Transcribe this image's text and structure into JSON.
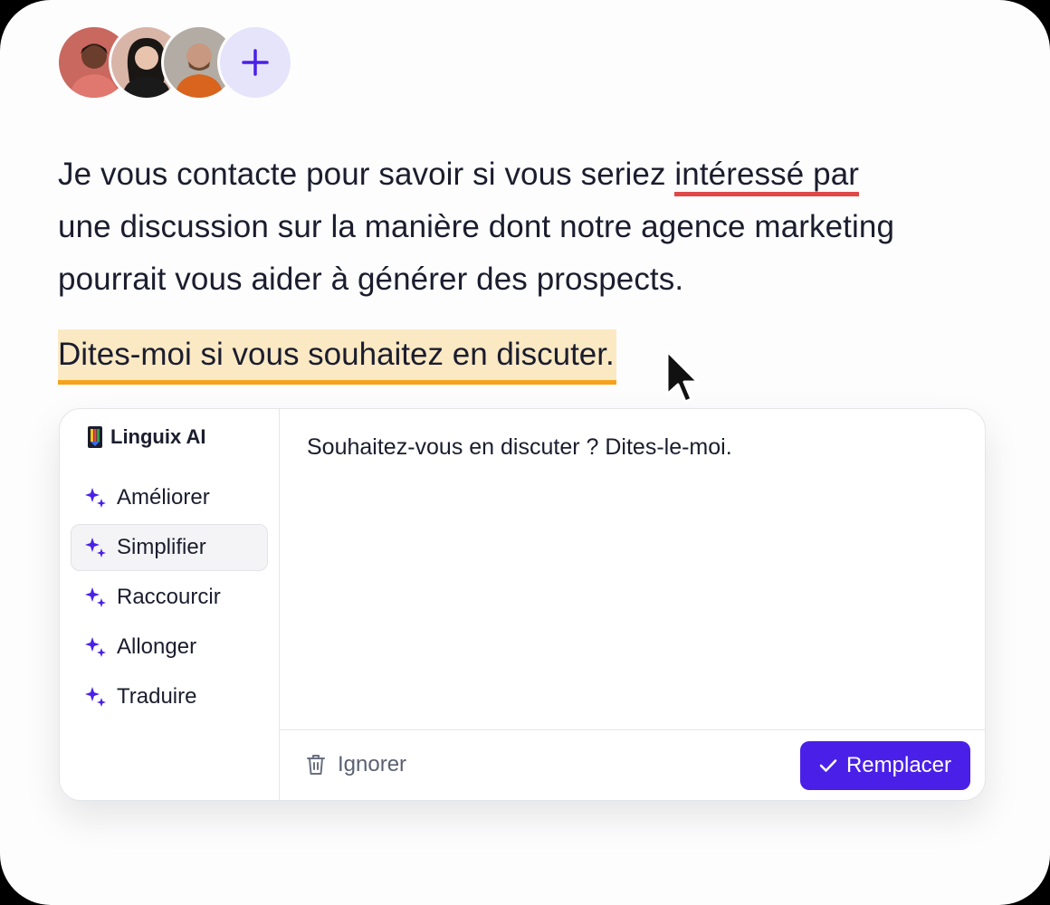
{
  "avatars": [
    {
      "name": "user-avatar-1"
    },
    {
      "name": "user-avatar-2"
    },
    {
      "name": "user-avatar-3"
    }
  ],
  "add_collaborator_icon": "plus-icon",
  "document": {
    "paragraph1": {
      "before": "Je vous contacte pour savoir si vous seriez ",
      "flagged": "intéressé par",
      "line2": "une discussion sur la manière dont notre agence marketing",
      "line3": "pourrait vous aider à générer des prospects."
    },
    "selected_sentence": "Dites-moi si vous souhaitez en discuter."
  },
  "colors": {
    "accent": "#4a20e8",
    "error_underline": "#e04848",
    "selection_bg": "#fbe9c4",
    "selection_underline": "#f6a21a"
  },
  "assistant": {
    "brand": "Linguix AI",
    "menu": [
      {
        "label": "Améliorer",
        "icon": "sparkle-icon",
        "active": false
      },
      {
        "label": "Simplifier",
        "icon": "sparkle-icon",
        "active": true
      },
      {
        "label": "Raccourcir",
        "icon": "sparkle-icon",
        "active": false
      },
      {
        "label": "Allonger",
        "icon": "sparkle-icon",
        "active": false
      },
      {
        "label": "Traduire",
        "icon": "sparkle-icon",
        "active": false
      }
    ],
    "suggestion": "Souhaitez-vous en discuter ? Dites-le-moi.",
    "ignore_label": "Ignorer",
    "replace_label": "Remplacer"
  }
}
